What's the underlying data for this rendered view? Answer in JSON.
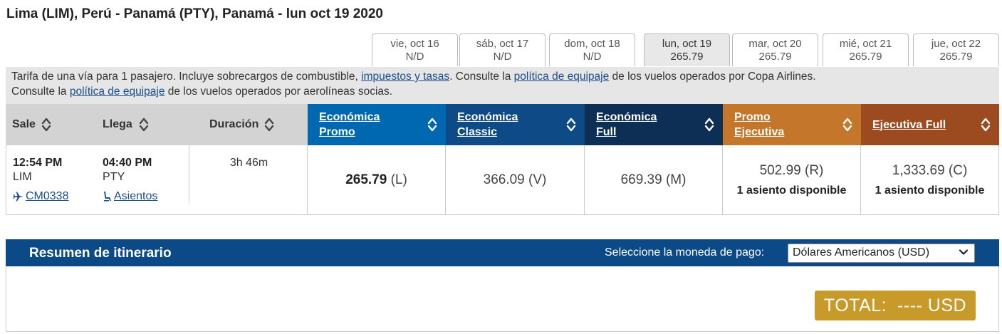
{
  "route_title": "Lima (LIM), Perú - Panamá (PTY), Panamá - lun oct 19 2020",
  "date_tabs": [
    {
      "day": "vie, oct 16",
      "price": "N/D"
    },
    {
      "day": "sáb, oct 17",
      "price": "N/D"
    },
    {
      "day": "dom, oct 18",
      "price": "N/D"
    },
    {
      "day": "lun, oct 19",
      "price": "265.79"
    },
    {
      "day": "mar, oct 20",
      "price": "265.79"
    },
    {
      "day": "mié, oct 21",
      "price": "265.79"
    },
    {
      "day": "jue, oct 22",
      "price": "265.79"
    }
  ],
  "fare_note": {
    "t1": "Tarifa de una vía para 1 pasajero. Incluye sobrecargos de combustible, ",
    "link1": "impuestos y tasas",
    "t2": ". Consulte la ",
    "link2": "política de equipaje",
    "t3": " de los vuelos operados por Copa Airlines.",
    "t4": "Consulte la ",
    "link3": "política de equipaje",
    "t5": " de los vuelos operados por aerolíneas socias."
  },
  "columns": {
    "sale": "Sale",
    "llega": "Llega",
    "duracion": "Duración",
    "fares": [
      {
        "line1": "Económica",
        "line2": "Promo",
        "color": "#0067b1"
      },
      {
        "line1": "Económica",
        "line2": "Classic",
        "color": "#0e4a86"
      },
      {
        "line1": "Económica",
        "line2": "Full",
        "color": "#0d2f55"
      },
      {
        "line1": "Promo",
        "line2": "Ejecutiva",
        "color": "#c4762b"
      },
      {
        "line1": "Ejecutiva Full",
        "line2": "",
        "color": "#9c4a1f"
      }
    ]
  },
  "flight": {
    "depart_time": "12:54 PM",
    "depart_code": "LIM",
    "flight_number": "CM0338",
    "arrive_time": "04:40 PM",
    "arrive_code": "PTY",
    "seats_link": "Asientos",
    "duration": "3h 46m",
    "fares": [
      {
        "price": "265.79",
        "class": " (L)",
        "avail": ""
      },
      {
        "price": "366.09 (V)",
        "class": "",
        "avail": ""
      },
      {
        "price": "669.39 (M)",
        "class": "",
        "avail": ""
      },
      {
        "price": "502.99 (R)",
        "class": "",
        "avail": "1 asiento disponible"
      },
      {
        "price": "1,333.69 (C)",
        "class": "",
        "avail": "1 asiento disponible"
      }
    ]
  },
  "summary": {
    "title": "Resumen de itinerario",
    "currency_label": "Seleccione la moneda de pago:",
    "currency_value": "Dólares Americanos (USD)",
    "total_label": "TOTAL:",
    "total_value": "---- USD",
    "total_color": "#c79a2a"
  }
}
